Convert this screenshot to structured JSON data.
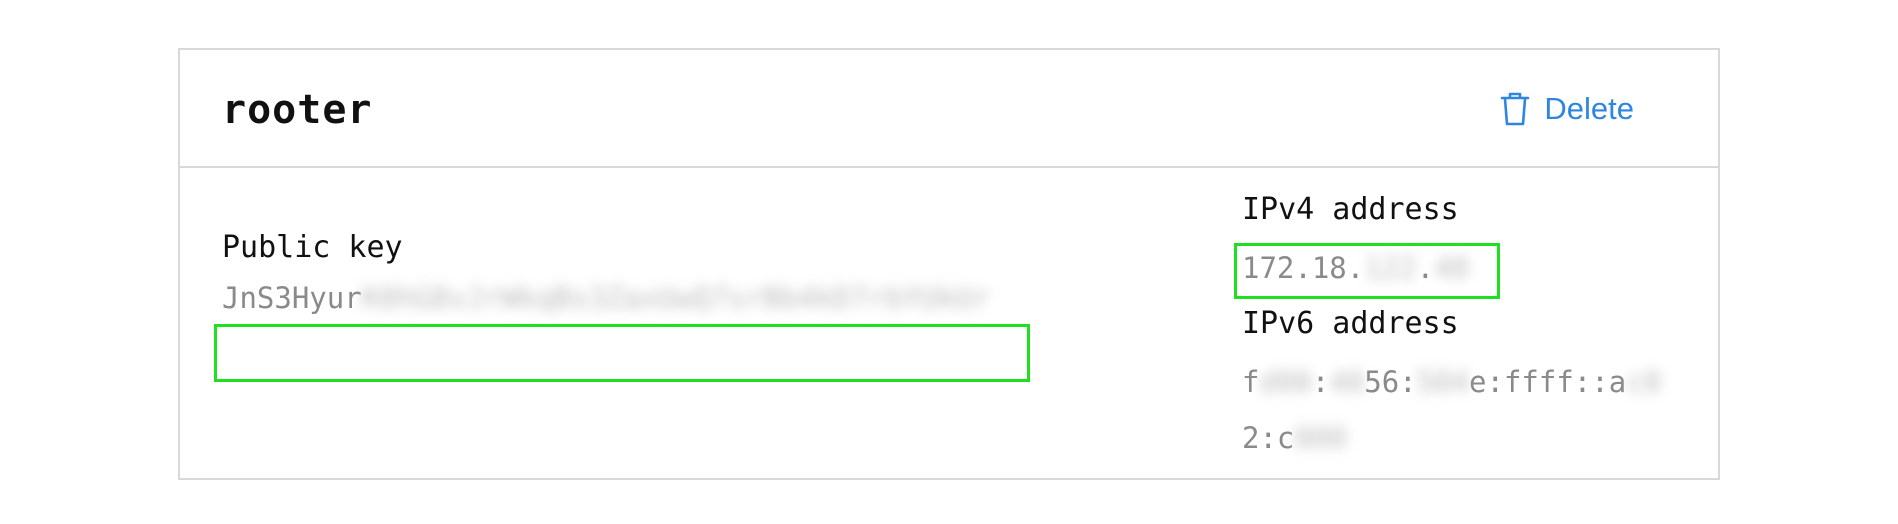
{
  "device": {
    "name": "rooter",
    "delete_label": "Delete"
  },
  "public_key": {
    "label": "Public key",
    "value_visible": "JnS3Hyur",
    "value_redacted": "K0hG8vJrWkqBs3ZaxUwQ7srBb4kD7rbYUkUr"
  },
  "ipv4": {
    "label": "IPv4 address",
    "value_visible": "172.18.",
    "value_redacted_1": "122",
    "sep": ".",
    "value_redacted_2": "40"
  },
  "ipv6": {
    "label": "IPv6 address",
    "line1_a": "f",
    "line1_r1": "d00",
    "line1_b": ":",
    "line1_r2": "40",
    "line1_c": "56:",
    "line1_r3": "504",
    "line1_d": "e:ffff::a",
    "line1_r4": "c0",
    "line2_a": "2:c",
    "line2_r1": "000"
  },
  "colors": {
    "accent": "#2e86e0",
    "highlight": "#1fe01f",
    "border": "#d9d9d9"
  },
  "icons": {
    "delete": "trash-icon"
  }
}
